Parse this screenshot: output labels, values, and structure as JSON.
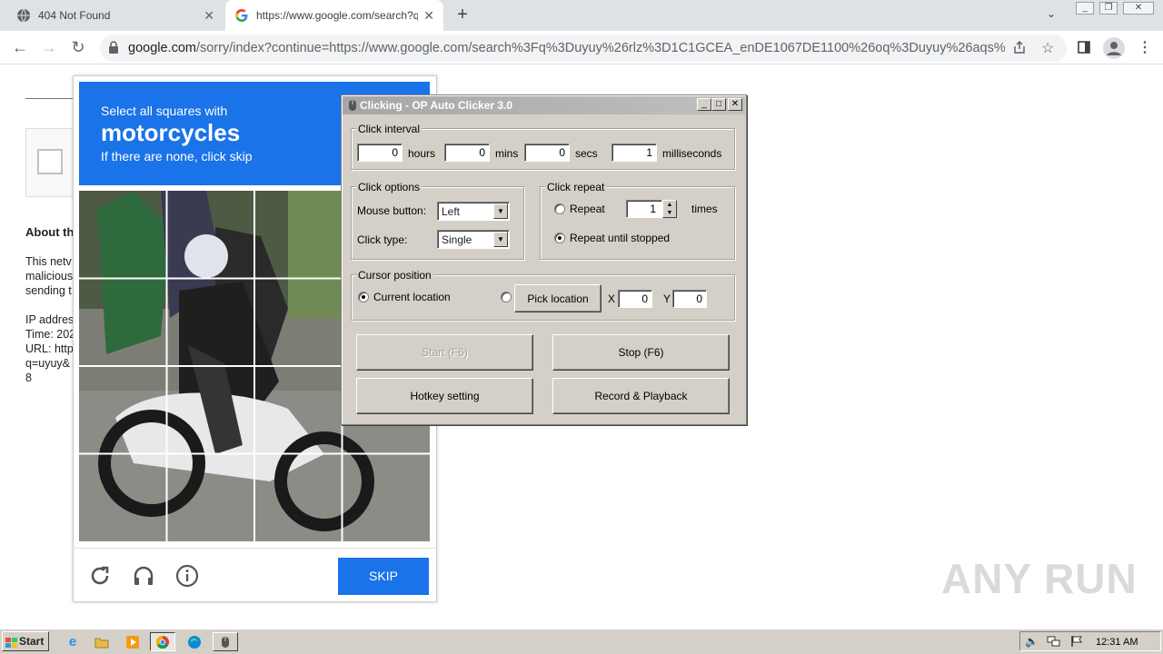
{
  "browser": {
    "tabs": [
      {
        "title": "404 Not Found",
        "icon": "globe-icon"
      },
      {
        "title": "https://www.google.com/search?q=",
        "icon": "google-g-icon",
        "active": true
      }
    ],
    "new_tab": "+",
    "url_host": "google.com",
    "url_rest": "/sorry/index?continue=https://www.google.com/search%3Fq%3Duyuy%26rlz%3D1C1GCEA_enDE1067DE1100%26oq%3Duyuy%26aqs%..."
  },
  "page": {
    "about": "About th",
    "lines1": [
      "This netv",
      "malicious",
      "sending t"
    ],
    "lines2": [
      "IP addres",
      "Time: 202",
      "URL: http",
      "q=uyuy&",
      "8"
    ]
  },
  "recaptcha": {
    "prompt_small": "Select all squares with",
    "prompt_big": "motorcycles",
    "prompt_note": "If there are none, click skip",
    "skip_label": "SKIP",
    "icons": [
      "reload-icon",
      "headphones-icon",
      "info-icon"
    ]
  },
  "clicker": {
    "title": "Clicking - OP Auto Clicker 3.0",
    "interval": {
      "group_label": "Click interval",
      "hours": "0",
      "hours_label": "hours",
      "mins": "0",
      "mins_label": "mins",
      "secs": "0",
      "secs_label": "secs",
      "ms": "1",
      "ms_label": "milliseconds"
    },
    "options": {
      "group_label": "Click options",
      "mouse_button_label": "Mouse button:",
      "mouse_button": "Left",
      "click_type_label": "Click type:",
      "click_type": "Single"
    },
    "repeat": {
      "group_label": "Click repeat",
      "repeat_label": "Repeat",
      "repeat_count": "1",
      "times_label": "times",
      "until_stopped_label": "Repeat until stopped"
    },
    "cursor": {
      "group_label": "Cursor position",
      "current_label": "Current location",
      "pick_label": "Pick location",
      "x_label": "X",
      "x": "0",
      "y_label": "Y",
      "y": "0"
    },
    "buttons": {
      "start": "Start (F6)",
      "stop": "Stop (F6)",
      "hotkey": "Hotkey setting",
      "record": "Record & Playback"
    }
  },
  "taskbar": {
    "start_label": "Start",
    "clock": "12:31 AM"
  },
  "watermark": "ANY RUN"
}
